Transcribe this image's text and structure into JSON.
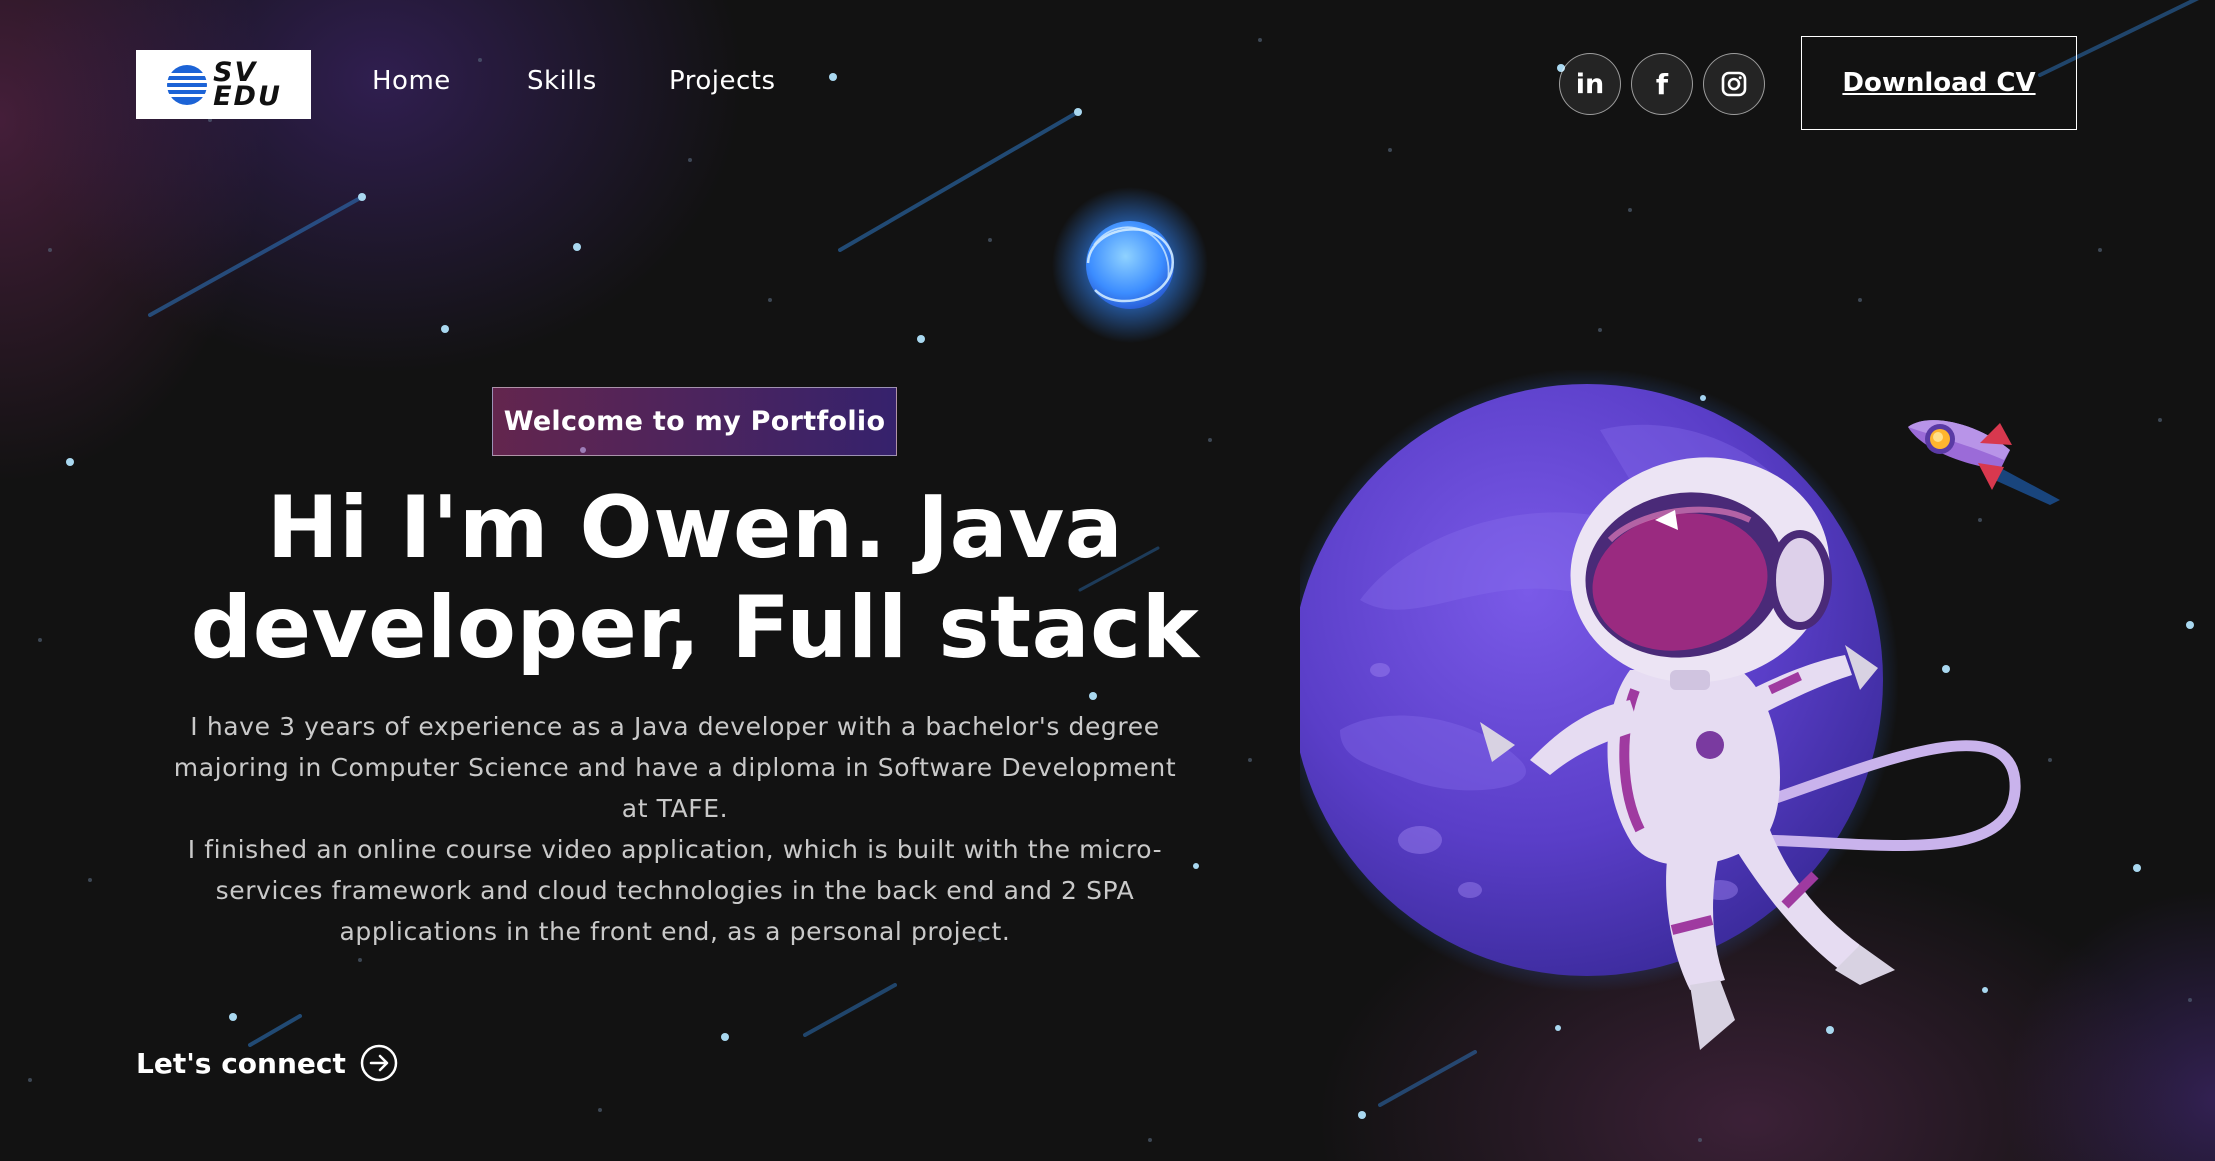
{
  "logo": {
    "line1": "SV",
    "line2": "EDU"
  },
  "nav": {
    "home": "Home",
    "skills": "Skills",
    "projects": "Projects"
  },
  "social": [
    "linkedin-icon",
    "facebook-icon",
    "instagram-icon"
  ],
  "cta": {
    "download_cv": "Download CV"
  },
  "hero": {
    "tagline": "Welcome to my Portfolio",
    "headline_line1": "Hi I'm Owen. Java",
    "headline_line2": "developer, Full stack",
    "description_lines": [
      "I have 3 years of experience as a Java developer with a bachelor's degree",
      "majoring in Computer Science and have a diploma in Software Development",
      "at TAFE.",
      "I finished an online course video application, which is built with the micro-",
      "services framework and cloud technologies in the back end and 2 SPA",
      "applications in the front end, as a personal project."
    ],
    "connect_label": "Let's connect"
  },
  "colors": {
    "background": "#121212",
    "tagline_gradient_start": "#AA367C",
    "tagline_gradient_end": "#4A2FBD",
    "planet": "#5b3fc4",
    "star": "#a9d8f0"
  }
}
